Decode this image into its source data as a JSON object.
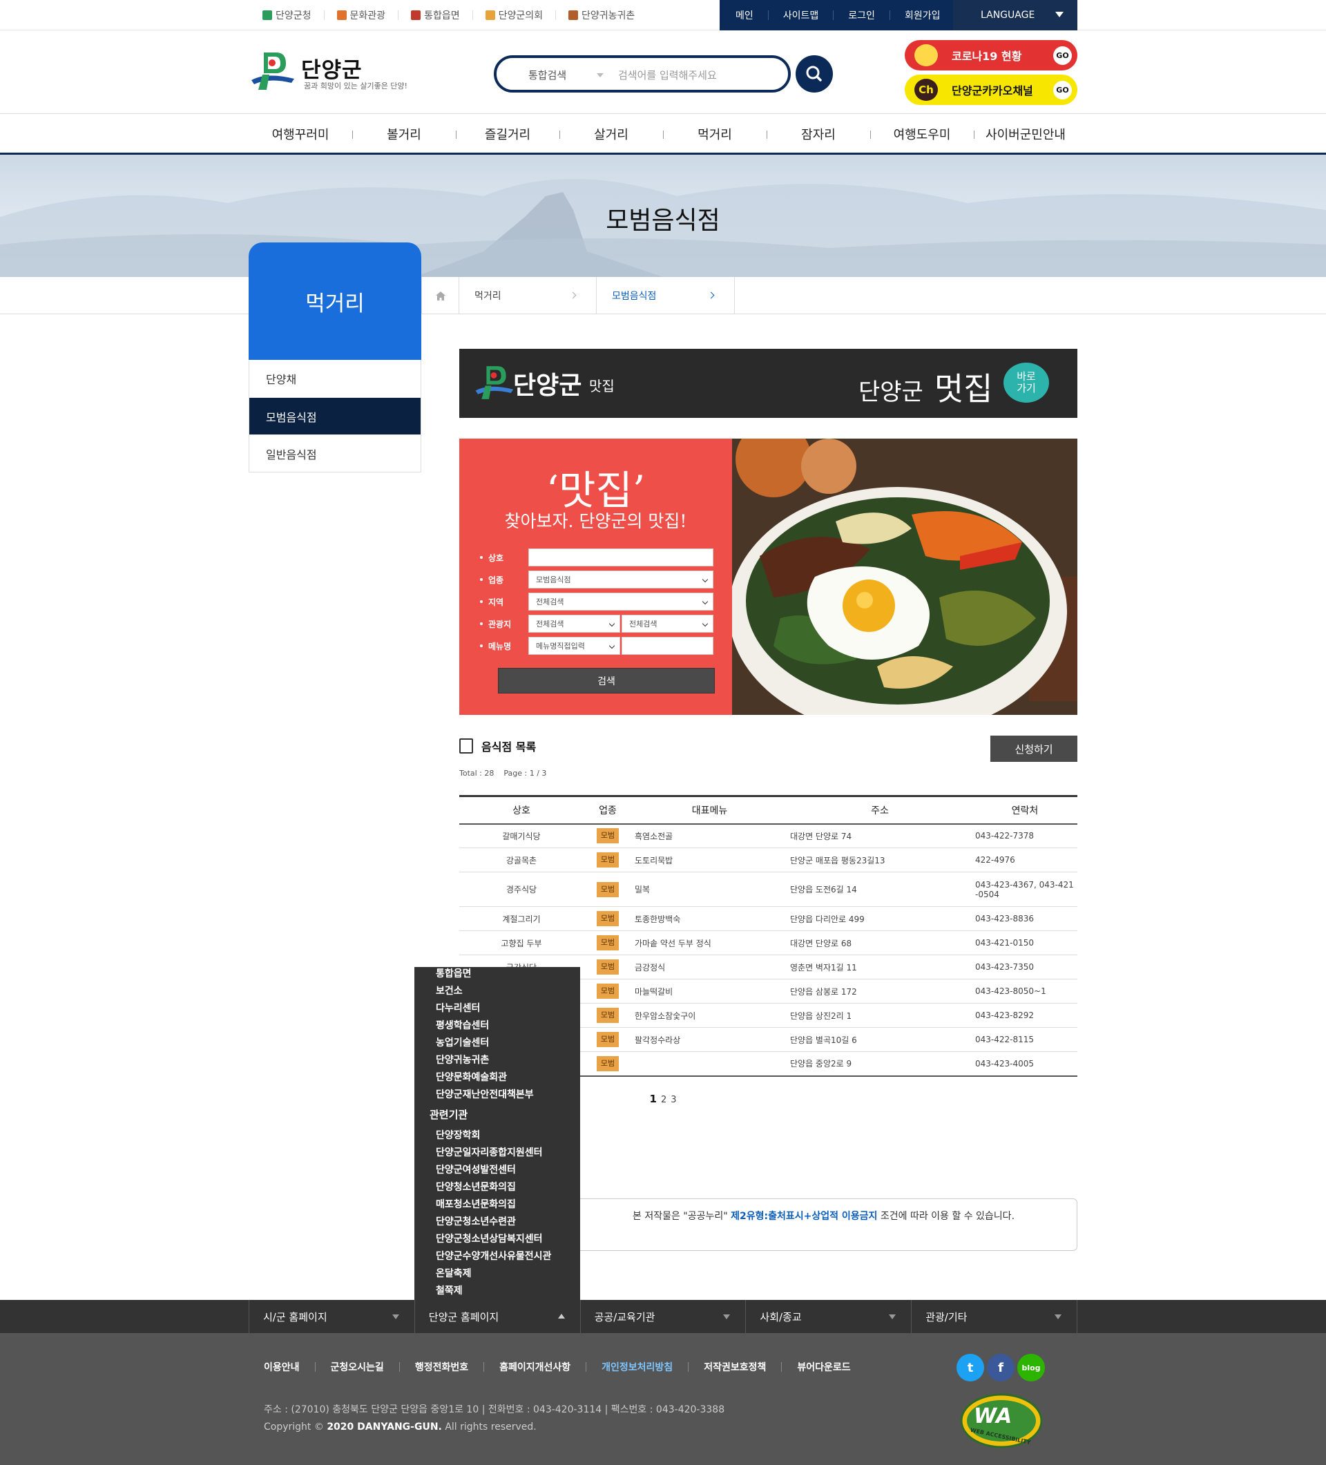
{
  "utility": {
    "site_links": [
      {
        "label": "단양군청",
        "icon": "danyang-logo-icon",
        "color": "#2a9d5c"
      },
      {
        "label": "문화관광",
        "icon": "camera-icon",
        "color": "#e1722b"
      },
      {
        "label": "통합읍면",
        "icon": "signpost-icon",
        "color": "#c0392b"
      },
      {
        "label": "단양군의회",
        "icon": "crown-icon",
        "color": "#e8a23a"
      },
      {
        "label": "단양귀농귀촌",
        "icon": "house-icon",
        "color": "#b05f2a"
      }
    ],
    "member_links": [
      "메인",
      "사이트맵",
      "로그인",
      "회원가입"
    ],
    "language": "LANGUAGE"
  },
  "header": {
    "logo_name": "단양군",
    "slogan": "꿈과 희망이 있는 살기좋은 단양!",
    "search": {
      "scope": "통합검색",
      "placeholder": "검색어를 입력해주세요",
      "icon": "search-icon"
    },
    "quick": [
      {
        "label": "코로나19 현황",
        "go": "GO",
        "color": "#e23232"
      },
      {
        "label": "단양군카카오채널",
        "go": "GO",
        "color": "#f7e600"
      }
    ]
  },
  "gnb": [
    "여행꾸러미",
    "볼거리",
    "즐길거리",
    "살거리",
    "먹거리",
    "잠자리",
    "여행도우미",
    "사이버군민안내"
  ],
  "page_title": "모범음식점",
  "location": {
    "level1": "먹거리",
    "level2": "모범음식점"
  },
  "lnb": {
    "title": "먹거리",
    "items": [
      {
        "label": "단양채",
        "active": false
      },
      {
        "label": "모범음식점",
        "active": true
      },
      {
        "label": "일반음식점",
        "active": false
      }
    ]
  },
  "banner": {
    "name": "단양군",
    "sub": "맛집",
    "right_a": "단양군",
    "right_b": "멋집",
    "go": "바로\n가기"
  },
  "search_form": {
    "title": "‘맛집’",
    "subtitle": "찾아보자. 단양군의 맛집!",
    "fields": [
      {
        "label": "상호",
        "value": ""
      },
      {
        "label": "업종",
        "value": "모범음식점"
      },
      {
        "label": "지역",
        "value": "전체검색"
      },
      {
        "label": "관광지",
        "value": "전체검색",
        "value2": "전체검색"
      },
      {
        "label": "메뉴명",
        "value": "메뉴명직접입력",
        "value2": ""
      }
    ],
    "submit": "검색"
  },
  "list": {
    "title": "음식점 목록",
    "apply": "신청하기",
    "total_label": "Total : 28",
    "page_label": "Page : 1 / 3",
    "columns": [
      "상호",
      "업종",
      "대표메뉴",
      "주소",
      "연락처"
    ],
    "rows": [
      {
        "name": "갈매기식당",
        "type": "모범",
        "menu": "흑염소전골",
        "addr": "대강면 단양로 74",
        "tel": "043-422-7378"
      },
      {
        "name": "강골목촌",
        "type": "모범",
        "menu": "도토리묵밥",
        "addr": "단양군 매포읍 평동23길13",
        "tel": "422-4976"
      },
      {
        "name": "경주식당",
        "type": "모범",
        "menu": "밀복",
        "addr": "단양읍 도전6길 14",
        "tel": "043-423-4367, 043-421-0504"
      },
      {
        "name": "계절그리기",
        "type": "모범",
        "menu": "토종한방백숙",
        "addr": "단양읍 다리안로 499",
        "tel": "043-423-8836"
      },
      {
        "name": "고향집 두부",
        "type": "모범",
        "menu": "가마솥 약선 두부 정식",
        "addr": "대강면 단양로 68",
        "tel": "043-421-0150"
      },
      {
        "name": "금강식당",
        "type": "모범",
        "menu": "금강정식",
        "addr": "영춘면 벽자1길 11",
        "tel": "043-423-7350"
      },
      {
        "name": "",
        "type": "모범",
        "menu": "마늘떡갈비",
        "addr": "단양읍 삼봉로 172",
        "tel": "043-423-8050~1"
      },
      {
        "name": "",
        "type": "모범",
        "menu": "한우암소참숯구이",
        "addr": "단양읍 상진2리 1",
        "tel": "043-423-8292"
      },
      {
        "name": "",
        "type": "모범",
        "menu": "팔각정수라상",
        "addr": "단양읍 별곡10길 6",
        "tel": "043-422-8115"
      },
      {
        "name": "",
        "type": "모범",
        "menu": "",
        "addr": "단양읍 중앙2로 9",
        "tel": "043-423-4005"
      }
    ],
    "pages": [
      "1",
      "2",
      "3"
    ]
  },
  "kogl": {
    "pre": "본 저작물은 \"공공누리\"",
    "link": "제2유형:출처표시+상업적 이용금지",
    "post": "조건에 따라 이용 할 수 있습니다."
  },
  "dropdown": {
    "items1": [
      "통합읍면",
      "보건소",
      "다누리센터",
      "평생학습센터",
      "농업기술센터",
      "단양귀농귀촌",
      "단양문화예술회관",
      "단양군재난안전대책본부"
    ],
    "group": "관련기관",
    "items2": [
      "단양장학회",
      "단양군일자리종합지원센터",
      "단양군여성발전센터",
      "단양청소년문화의집",
      "매포청소년문화의집",
      "단양군청소년수련관",
      "단양군청소년상담복지센터",
      "단양군수양개선사유물전시관",
      "온달축제",
      "철쭉제"
    ]
  },
  "footer": {
    "selects": [
      "시/군 홈페이지",
      "단양군 홈페이지",
      "공공/교육기관",
      "사회/종교",
      "관광/기타"
    ],
    "nav": [
      {
        "label": "이용안내",
        "highlight": false
      },
      {
        "label": "군청오시는길",
        "highlight": false
      },
      {
        "label": "행정전화번호",
        "highlight": false
      },
      {
        "label": "홈페이지개선사항",
        "highlight": false
      },
      {
        "label": "개인정보처리방침",
        "highlight": true
      },
      {
        "label": "저작권보호정책",
        "highlight": false
      },
      {
        "label": "뷰어다운로드",
        "highlight": false
      }
    ],
    "address": "주소 : (27010) 충청북도 단양군 단양읍 중앙1로 10 | 전화번호 : 043-420-3114 | 팩스번호 : 043-420-3388",
    "copy_pre": "Copyright © ",
    "copy_bold": "2020 DANYANG-GUN.",
    "copy_post": " All rights reserved.",
    "sns": [
      {
        "icon": "twitter-icon",
        "glyph": "t",
        "color": "#1da1f2"
      },
      {
        "icon": "facebook-icon",
        "glyph": "f",
        "color": "#3b5998"
      },
      {
        "icon": "blog-icon",
        "glyph": "blog",
        "color": "#2db400"
      }
    ],
    "wa_label": "WA",
    "wa_sub": "WEB ACCESSIBILITY"
  }
}
